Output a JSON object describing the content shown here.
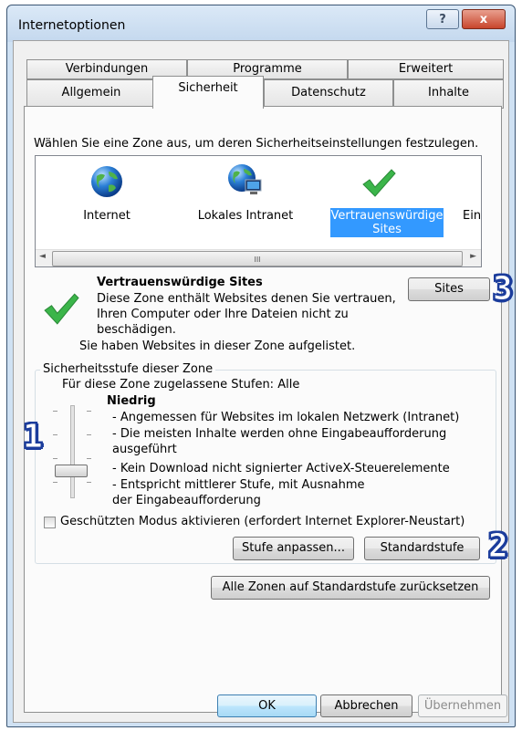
{
  "window": {
    "title": "Internetoptionen",
    "help_glyph": "?",
    "close_glyph": "x"
  },
  "tabs_row1": [
    "Verbindungen",
    "Programme",
    "Erweitert"
  ],
  "tabs_row2": [
    "Allgemein",
    "Sicherheit",
    "Datenschutz",
    "Inhalte"
  ],
  "security": {
    "instruction": "Wählen Sie eine Zone aus, um deren Sicherheitseinstellungen festzulegen.",
    "zones": [
      {
        "label": "Internet",
        "icon": "globe-icon"
      },
      {
        "label": "Lokales Intranet",
        "icon": "intranet-globe-icon"
      },
      {
        "label": "Vertrauenswürdige Sites",
        "icon": "checkmark-icon",
        "selected": true
      },
      {
        "label": "Einge",
        "icon": "restricted-icon"
      }
    ],
    "scroll_left": "◄",
    "scroll_grip": "III",
    "scroll_right": "►",
    "zone_info": {
      "title": "Vertrauenswürdige Sites",
      "description": "Diese Zone enthält Websites denen Sie vertrauen, Ihren Computer oder Ihre Dateien nicht zu beschädigen.",
      "note": "Sie haben Websites in dieser Zone aufgelistet.",
      "sites_button": "Sites"
    },
    "level_group": {
      "legend": "Sicherheitsstufe dieser Zone",
      "allowed": "Für diese Zone zugelassene Stufen: Alle",
      "level_name": "Niedrig",
      "bullets": [
        "- Angemessen für Websites im lokalen Netzwerk (Intranet)",
        "- Die meisten Inhalte werden ohne Eingabeaufforderung ausgeführt",
        "- Kein Download nicht signierter ActiveX-Steuerelemente",
        "- Entspricht mittlerer Stufe, mit Ausnahme der Eingabeaufforderung"
      ],
      "protected_mode": "Geschützten Modus aktivieren (erfordert Internet Explorer-Neustart)",
      "protected_mode_checked": false,
      "custom_button": "Stufe anpassen...",
      "default_button": "Standardstufe"
    },
    "reset_all_button": "Alle Zonen auf Standardstufe zurücksetzen"
  },
  "footer": {
    "ok": "OK",
    "cancel": "Abbrechen",
    "apply": "Übernehmen"
  },
  "annotations": [
    "1",
    "2",
    "3"
  ],
  "colors": {
    "selection": "#3399ff",
    "annotation": "#1c3d9c",
    "check": "#3bb54a"
  }
}
